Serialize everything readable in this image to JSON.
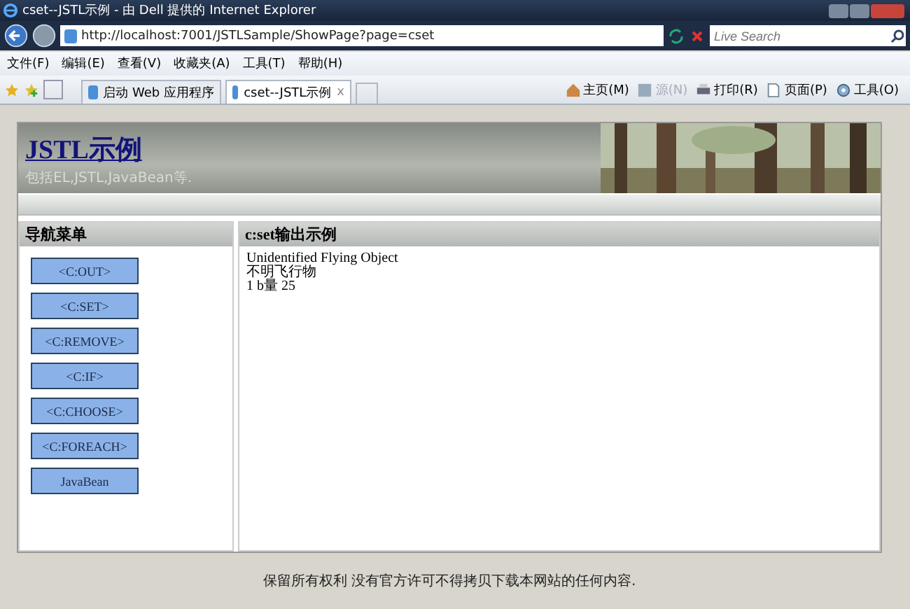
{
  "window": {
    "title": "cset--JSTL示例 - 由 Dell 提供的 Internet Explorer"
  },
  "address_bar": {
    "url": "http://localhost:7001/JSTLSample/ShowPage?page=cset"
  },
  "search": {
    "placeholder": "Live Search"
  },
  "menu": [
    "文件(F)",
    "编辑(E)",
    "查看(V)",
    "收藏夹(A)",
    "工具(T)",
    "帮助(H)"
  ],
  "tabs": [
    {
      "label": "启动 Web 应用程序",
      "selected": false
    },
    {
      "label": "cset--JSTL示例",
      "selected": true,
      "close": "x"
    }
  ],
  "commands": [
    {
      "label": "主页(M)",
      "disabled": false,
      "kind": "home"
    },
    {
      "label": "源(N)",
      "disabled": true,
      "kind": "feed"
    },
    {
      "label": "打印(R)",
      "disabled": false,
      "kind": "print"
    },
    {
      "label": "页面(P)",
      "disabled": false,
      "kind": "page"
    },
    {
      "label": "工具(O)",
      "disabled": false,
      "kind": "tools"
    }
  ],
  "page": {
    "title": "JSTL示例",
    "subtitle": "包括EL,JSTL,JavaBean等.",
    "nav": {
      "heading": "导航菜单",
      "items": [
        "<C:OUT>",
        "<C:SET>",
        "<C:REMOVE>",
        "<C:IF>",
        "<C:CHOOSE>",
        "<C:FOREACH>",
        "JavaBean"
      ]
    },
    "content": {
      "heading": "c:set输出示例",
      "lines": [
        "Unidentified Flying Object",
        "不明飞行物",
        "1 b量 25"
      ]
    },
    "footer": "保留所有权利 没有官方许可不得拷贝下载本网站的任何内容."
  }
}
